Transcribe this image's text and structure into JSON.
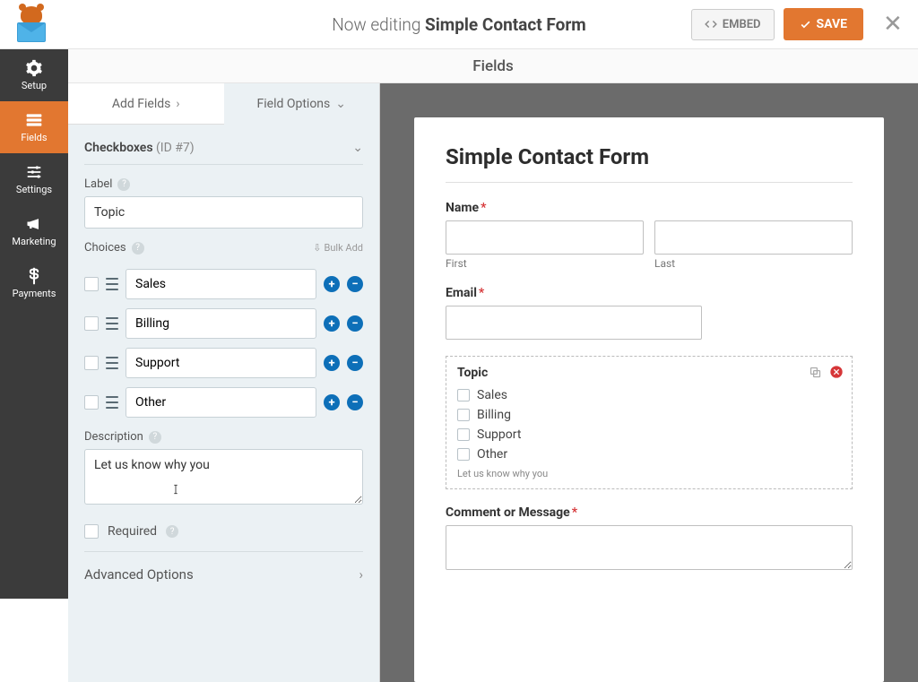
{
  "header": {
    "editing_prefix": "Now editing ",
    "form_name": "Simple Contact Form",
    "embed_label": "EMBED",
    "save_label": "SAVE"
  },
  "section_title": "Fields",
  "sidebar": {
    "items": [
      {
        "label": "Setup"
      },
      {
        "label": "Fields"
      },
      {
        "label": "Settings"
      },
      {
        "label": "Marketing"
      },
      {
        "label": "Payments"
      }
    ]
  },
  "panel": {
    "tabs": {
      "add": "Add Fields",
      "options": "Field Options"
    },
    "field_type": "Checkboxes",
    "field_id": "(ID #7)",
    "label_heading": "Label",
    "label_value": "Topic",
    "choices_heading": "Choices",
    "bulk_add": "Bulk Add",
    "choices": [
      "Sales",
      "Billing",
      "Support",
      "Other"
    ],
    "description_heading": "Description",
    "description_value": "Let us know why you",
    "required_label": "Required",
    "advanced_label": "Advanced Options"
  },
  "preview": {
    "title": "Simple Contact Form",
    "name_label": "Name",
    "first_label": "First",
    "last_label": "Last",
    "email_label": "Email",
    "topic_label": "Topic",
    "topic_choices": [
      "Sales",
      "Billing",
      "Support",
      "Other"
    ],
    "topic_desc": "Let us know why you",
    "comment_label": "Comment or Message"
  }
}
